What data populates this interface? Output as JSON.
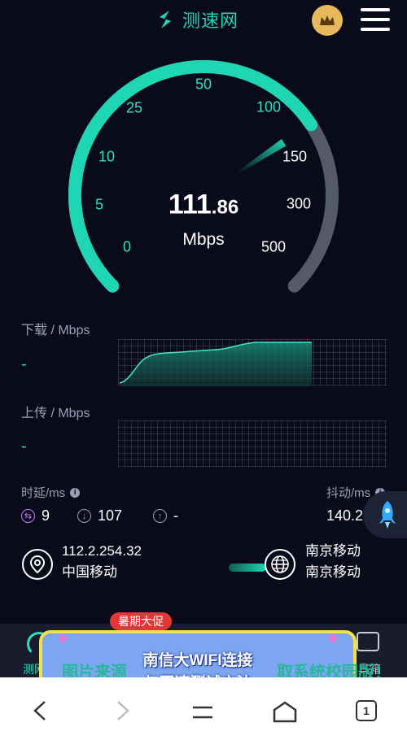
{
  "header": {
    "app_name": "测速网",
    "crown_icon": "crown-icon",
    "menu_icon": "menu-icon"
  },
  "gauge": {
    "ticks": [
      "0",
      "5",
      "10",
      "25",
      "50",
      "100",
      "150",
      "300",
      "500"
    ],
    "speed_integer": "111",
    "speed_decimal": ".86",
    "unit": "Mbps",
    "progress_fraction": 0.71,
    "accent": "#1fd6b4",
    "track": "#555a6a"
  },
  "download": {
    "label": "下载 / Mbps",
    "value": "-"
  },
  "upload": {
    "label": "上传 / Mbps",
    "value": "-"
  },
  "latency": {
    "label": "时延/ms",
    "ping": "9",
    "down": "107",
    "up": "-"
  },
  "jitter": {
    "label": "抖动/ms",
    "value": "140.2"
  },
  "client": {
    "ip": "112.2.254.32",
    "isp": "中国移动"
  },
  "server": {
    "name": "南京移动",
    "isp": "南京移动"
  },
  "tabbar": {
    "left_label": "测网",
    "right_label": "具箱"
  },
  "promo": {
    "tag": "暑期大促",
    "line1": "南信大WIFI连接",
    "line2": "与网速测试方法",
    "ticker_left": "图片来源",
    "ticker_right": "取系统校园版！"
  },
  "navbar": {
    "tab_count": "1"
  }
}
